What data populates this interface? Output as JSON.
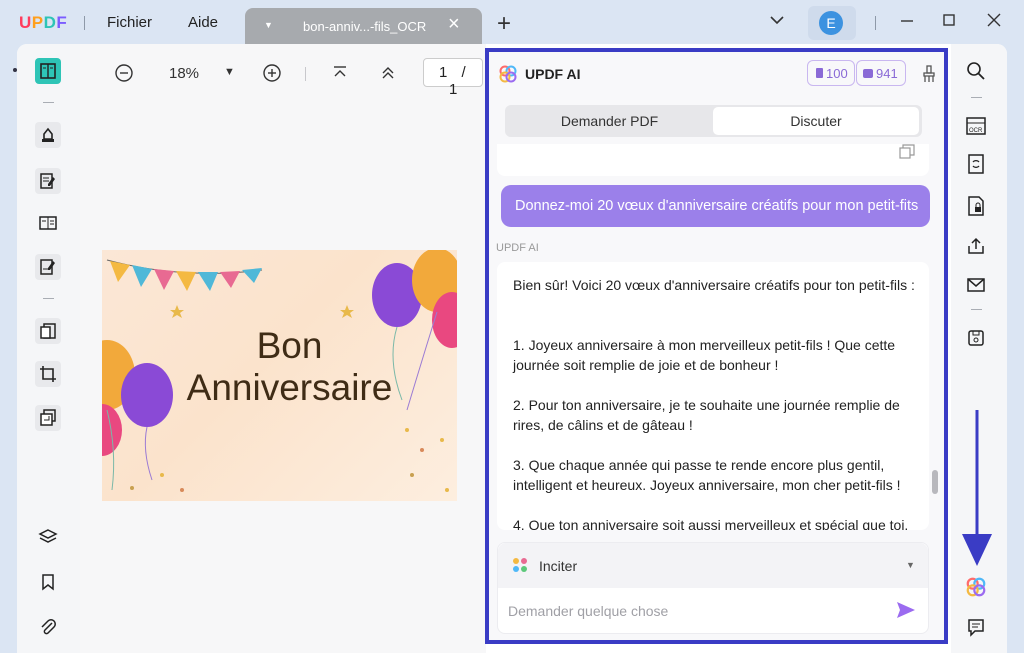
{
  "app": {
    "logo": "UPDF",
    "logo_colors": [
      "#ff3b5c",
      "#ff9f1c",
      "#2ec4b6",
      "#7b5cff"
    ],
    "menu": {
      "file": "Fichier",
      "help": "Aide"
    },
    "tab_title": "bon-anniv...-fils_OCR",
    "avatar_letter": "E",
    "accent": "#3a3cc5"
  },
  "toolbar": {
    "zoom_level": "18%",
    "page_current": "1",
    "page_sep": "/",
    "page_total": "1"
  },
  "document": {
    "card_line1": "Bon",
    "card_line2": "Anniversaire"
  },
  "ai_panel": {
    "title": "UPDF AI",
    "badge_pages": "100",
    "badge_chats": "941",
    "mode_tabs": [
      "Demander PDF",
      "Discuter"
    ],
    "active_mode": "Discuter",
    "user_message": "Donnez-moi 20 vœux d'anniversaire créatifs pour mon petit-fits",
    "ai_label": "UPDF AI",
    "ai_paragraphs": [
      "Bien sûr! Voici 20 vœux d'anniversaire créatifs pour ton petit-fils :",
      "1. Joyeux anniversaire à mon merveilleux petit-fils ! Que cette journée soit remplie de joie et de bonheur !",
      "2. Pour ton anniversaire, je te souhaite une journée remplie de rires, de câlins et de gâteau !",
      "3. Que chaque année qui passe te rende encore plus gentil, intelligent et heureux. Joyeux anniversaire, mon cher petit-fils !",
      "4. Que ton anniversaire soit aussi merveilleux et spécial que toi."
    ],
    "prompt_label": "Inciter",
    "input_placeholder": "Demander quelque chose"
  }
}
